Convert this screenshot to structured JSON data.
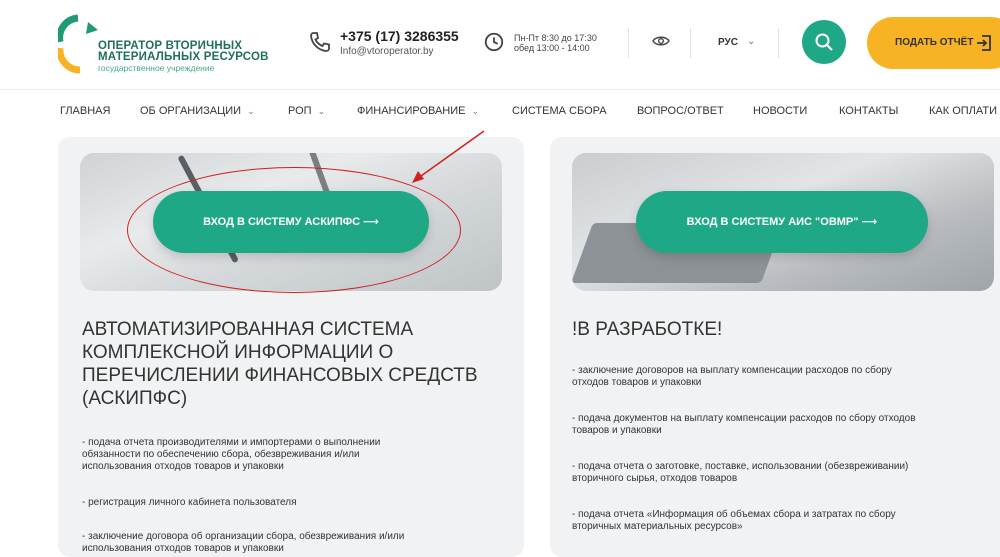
{
  "header": {
    "logo": {
      "line1": "ОПЕРАТОР ВТОРИЧНЫХ",
      "line2": "МАТЕРИАЛЬНЫХ РЕСУРСОВ",
      "line3": "государственное учреждение",
      "colors": [
        "#1f6f5a",
        "#44aa88",
        "#f7b324"
      ]
    },
    "phone": "+375 (17) 3286355",
    "email": "Info@vtoroperator.by",
    "hours_line1": "Пн-Пт 8:30 до 17:30",
    "hours_line2": "обед 13:00 - 14:00",
    "language": "РУС",
    "report_button": "ПОДАТЬ ОТЧЁТ",
    "accent": "#1fa886",
    "report_color": "#f7b324"
  },
  "nav": {
    "items": [
      {
        "label": "ГЛАВНАЯ",
        "has_dropdown": false
      },
      {
        "label": "ОБ ОРГАНИЗАЦИИ",
        "has_dropdown": true
      },
      {
        "label": "РОП",
        "has_dropdown": true
      },
      {
        "label": "ФИНАНСИРОВАНИЕ",
        "has_dropdown": true
      },
      {
        "label": "СИСТЕМА СБОРА",
        "has_dropdown": false
      },
      {
        "label": "ВОПРОС/ОТВЕТ",
        "has_dropdown": false
      },
      {
        "label": "НОВОСТИ",
        "has_dropdown": false
      },
      {
        "label": "КОНТАКТЫ",
        "has_dropdown": false
      },
      {
        "label": "КАК ОПЛАТИ",
        "has_dropdown": false
      }
    ]
  },
  "cards": [
    {
      "button": "ВХОД В СИСТЕМУ АСКИПФС  ⟶",
      "heading_lines": [
        "АВТОМАТИЗИРОВАННАЯ СИСТЕМА",
        "КОМПЛЕКСНОЙ ИНФОРМАЦИИ О",
        "ПЕРЕЧИСЛЕНИИ ФИНАНСОВЫХ СРЕДСТВ",
        "(АСКИПФС)"
      ],
      "items": [
        [
          "- подача отчета производителями и импортерами о выполнении",
          "обязанности по обеспечению сбора, обезвреживания и/или",
          "использования отходов товаров и упаковки"
        ],
        [
          "- регистрация личного кабинета пользователя"
        ],
        [
          "- заключение договора об организации сбора, обезвреживания и/или",
          "использования отходов товаров и упаковки"
        ]
      ]
    },
    {
      "button": "ВХОД В СИСТЕМУ АИС \"ОВМР\"  ⟶",
      "heading_lines": [
        "!В РАЗРАБОТКЕ!"
      ],
      "items": [
        [
          "- заключение договоров на выплату компенсации расходов по сбору",
          "отходов товаров и упаковки"
        ],
        [
          "- подача документов на выплату компенсации расходов по сбору отходов",
          "товаров и упаковки"
        ],
        [
          "- подача отчета о заготовке, поставке, использовании (обезвреживании)",
          "вторичного сырья, отходов товаров"
        ],
        [
          "- подача отчета «Информация об объемах сбора и затратах по сбору",
          "вторичных материальных ресурсов»"
        ]
      ]
    }
  ],
  "annotation_color": "#d02020"
}
